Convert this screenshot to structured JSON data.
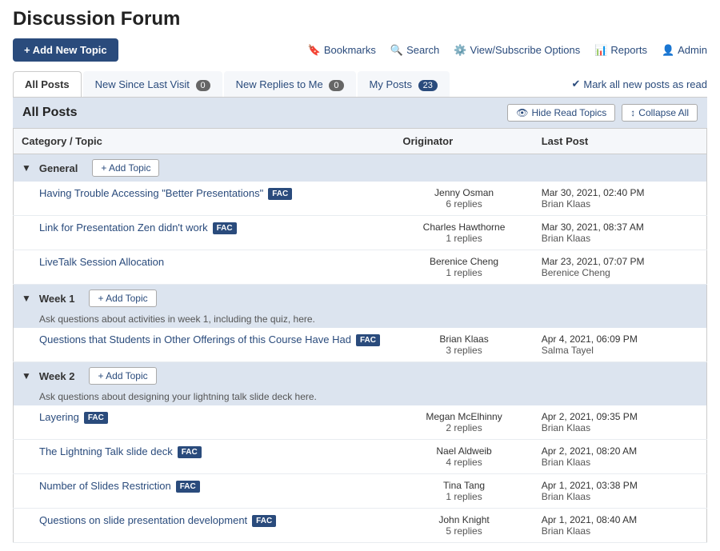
{
  "page": {
    "title": "Discussion Forum"
  },
  "toolbar": {
    "add_topic_label": "+ Add New Topic",
    "bookmarks_label": "Bookmarks",
    "search_label": "Search",
    "view_subscribe_label": "View/Subscribe Options",
    "reports_label": "Reports",
    "admin_label": "Admin"
  },
  "tabs": [
    {
      "id": "all-posts",
      "label": "All Posts",
      "badge": null,
      "active": true
    },
    {
      "id": "new-since",
      "label": "New Since Last Visit",
      "badge": "0",
      "active": false
    },
    {
      "id": "new-replies",
      "label": "New Replies to Me",
      "badge": "0",
      "active": false
    },
    {
      "id": "my-posts",
      "label": "My Posts",
      "badge": "23",
      "active": false
    }
  ],
  "mark_all_label": "Mark all new posts as read",
  "section_title": "All Posts",
  "hide_read_label": "Hide Read Topics",
  "collapse_all_label": "Collapse All",
  "table_headers": {
    "topic": "Category / Topic",
    "originator": "Originator",
    "last_post": "Last Post"
  },
  "groups": [
    {
      "name": "General",
      "description": "",
      "add_topic_label": "+ Add Topic",
      "topics": [
        {
          "title": "Having Trouble Accessing \"Better Presentations\"",
          "fac": true,
          "originator": "Jenny Osman",
          "replies": "6 replies",
          "last_post_date": "Mar 30, 2021, 02:40 PM",
          "last_post_user": "Brian Klaas"
        },
        {
          "title": "Link for Presentation Zen didn't work",
          "fac": true,
          "originator": "Charles Hawthorne",
          "replies": "1 replies",
          "last_post_date": "Mar 30, 2021, 08:37 AM",
          "last_post_user": "Brian Klaas"
        },
        {
          "title": "LiveTalk Session Allocation",
          "fac": false,
          "originator": "Berenice Cheng",
          "replies": "1 replies",
          "last_post_date": "Mar 23, 2021, 07:07 PM",
          "last_post_user": "Berenice Cheng"
        }
      ]
    },
    {
      "name": "Week 1",
      "description": "Ask questions about activities in week 1, including the quiz, here.",
      "add_topic_label": "+ Add Topic",
      "topics": [
        {
          "title": "Questions that Students in Other Offerings of this Course Have Had",
          "fac": true,
          "originator": "Brian Klaas",
          "replies": "3 replies",
          "last_post_date": "Apr 4, 2021, 06:09 PM",
          "last_post_user": "Salma Tayel"
        }
      ]
    },
    {
      "name": "Week 2",
      "description": "Ask questions about designing your lightning talk slide deck here.",
      "add_topic_label": "+ Add Topic",
      "topics": [
        {
          "title": "Layering",
          "fac": true,
          "originator": "Megan McElhinny",
          "replies": "2 replies",
          "last_post_date": "Apr 2, 2021, 09:35 PM",
          "last_post_user": "Brian Klaas"
        },
        {
          "title": "The Lightning Talk slide deck",
          "fac": true,
          "originator": "Nael Aldweib",
          "replies": "4 replies",
          "last_post_date": "Apr 2, 2021, 08:20 AM",
          "last_post_user": "Brian Klaas"
        },
        {
          "title": "Number of Slides Restriction",
          "fac": true,
          "originator": "Tina Tang",
          "replies": "1 replies",
          "last_post_date": "Apr 1, 2021, 03:38 PM",
          "last_post_user": "Brian Klaas"
        },
        {
          "title": "Questions on slide presentation development",
          "fac": true,
          "originator": "John Knight",
          "replies": "5 replies",
          "last_post_date": "Apr 1, 2021, 08:40 AM",
          "last_post_user": "Brian Klaas"
        }
      ]
    }
  ]
}
